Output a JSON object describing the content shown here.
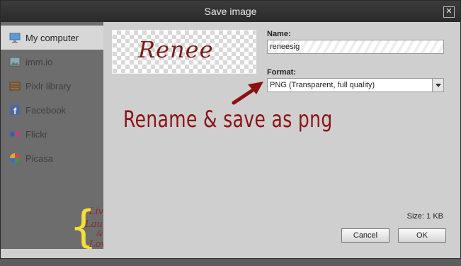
{
  "dialog": {
    "title": "Save image",
    "close_glyph": "✕"
  },
  "sidebar": {
    "items": [
      {
        "label": "My computer",
        "icon": "monitor-icon",
        "active": true
      },
      {
        "label": "imm.io",
        "icon": "image-icon"
      },
      {
        "label": "Pixlr library",
        "icon": "library-icon"
      },
      {
        "label": "Facebook",
        "icon": "facebook-icon"
      },
      {
        "label": "Flickr",
        "icon": "flickr-icon"
      },
      {
        "label": "Picasa",
        "icon": "picasa-icon"
      }
    ]
  },
  "preview": {
    "text": "Renee"
  },
  "form": {
    "name_label": "Name:",
    "name_value": "reneesig",
    "format_label": "Format:",
    "format_value": "PNG (Transparent, full quality)",
    "size_text": "Size: 1 KB"
  },
  "annotation": {
    "text": "Rename & save as png",
    "color": "#8b1212"
  },
  "buttons": {
    "cancel": "Cancel",
    "ok": "OK"
  },
  "logo": {
    "lines": [
      "Living",
      "Laughing",
      "&",
      "Loving"
    ],
    "brace_color": "#f3df3a",
    "text_color": "#8b2a2a"
  }
}
